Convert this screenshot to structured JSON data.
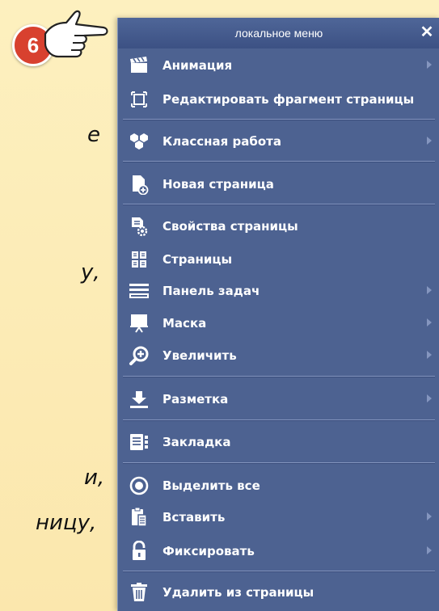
{
  "background": {
    "text_fragments": [
      "е",
      "у,",
      "и,",
      "ницу,"
    ]
  },
  "step_badge": "6",
  "menu": {
    "title": "локальное меню",
    "close": "✕",
    "items": [
      {
        "label": "Анимация",
        "icon": "clapperboard-icon",
        "submenu": true
      },
      {
        "label": "Редактировать фрагмент страницы",
        "icon": "crop-frame-icon",
        "submenu": false
      },
      {
        "label": "Классная работа",
        "icon": "hexagons-icon",
        "submenu": true
      },
      {
        "label": "Новая страница",
        "icon": "new-page-icon",
        "submenu": false
      },
      {
        "label": "Свойства страницы",
        "icon": "page-settings-icon",
        "submenu": false
      },
      {
        "label": "Страницы",
        "icon": "pages-grid-icon",
        "submenu": false
      },
      {
        "label": "Панель задач",
        "icon": "taskbar-icon",
        "submenu": true
      },
      {
        "label": "Маска",
        "icon": "easel-icon",
        "submenu": true
      },
      {
        "label": "Увеличить",
        "icon": "zoom-in-icon",
        "submenu": true
      },
      {
        "label": "Разметка",
        "icon": "download-arrow-icon",
        "submenu": true
      },
      {
        "label": "Закладка",
        "icon": "bookmark-icon",
        "submenu": false
      },
      {
        "label": "Выделить все",
        "icon": "select-all-icon",
        "submenu": false
      },
      {
        "label": "Вставить",
        "icon": "paste-icon",
        "submenu": true
      },
      {
        "label": "Фиксировать",
        "icon": "lock-icon",
        "submenu": true
      },
      {
        "label": "Удалить из страницы",
        "icon": "trash-icon",
        "submenu": false
      }
    ]
  }
}
